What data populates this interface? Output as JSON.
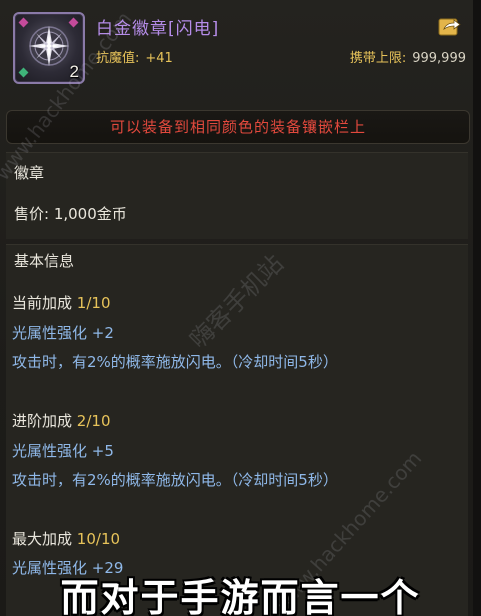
{
  "item": {
    "icon": "star-badge-icon",
    "count": "2",
    "title": "白金徽章[闪电]",
    "stat_label": "抗魔值:",
    "stat_value": "+41",
    "carry_label": "携带上限:",
    "carry_value": "999,999"
  },
  "notice": "可以装备到相同颜色的装备镶嵌栏上",
  "category": {
    "type": "徽章",
    "price": "售价: 1,000金币"
  },
  "basic": {
    "heading": "基本信息",
    "tiers": [
      {
        "label": "当前加成",
        "value": "1/10",
        "stat": "光属性强化 +2",
        "effect": "攻击时，有2%的概率施放闪电。（冷却时间5秒）"
      },
      {
        "label": "进阶加成",
        "value": "2/10",
        "stat": "光属性强化 +5",
        "effect": "攻击时，有2%的概率施放闪电。（冷却时间5秒）"
      },
      {
        "label": "最大加成",
        "value": "10/10",
        "stat": "光属性强化 +29"
      }
    ]
  },
  "subtitle": "而对于手游而言一个",
  "watermarks": {
    "url1": "www.hackhome.com",
    "site": "嗨客手机站",
    "url2": "www.hackhome.com"
  },
  "colors": {
    "title": "#b58ce8",
    "gold": "#e7c35a",
    "notice": "#e2493d",
    "stat_blue": "#8fb8e8"
  }
}
